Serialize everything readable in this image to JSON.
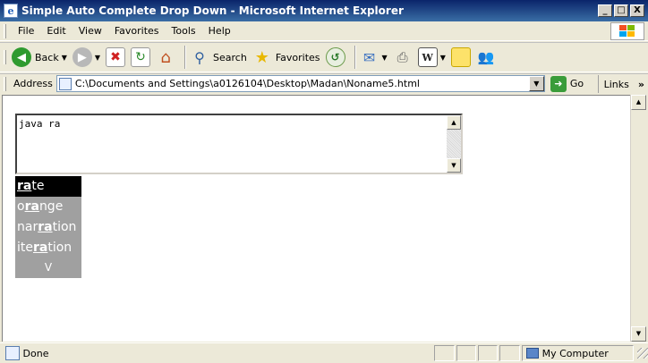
{
  "window": {
    "title": "Simple Auto Complete Drop Down - Microsoft Internet Explorer",
    "minimize": "_",
    "maximize": "□",
    "close": "X"
  },
  "menu": [
    "File",
    "Edit",
    "View",
    "Favorites",
    "Tools",
    "Help"
  ],
  "toolbar": {
    "back_label": "Back",
    "search_label": "Search",
    "favorites_label": "Favorites"
  },
  "address": {
    "label": "Address",
    "url": "C:\\Documents and Settings\\a0126104\\Desktop\\Madan\\Noname5.html",
    "go_label": "Go",
    "links_label": "Links"
  },
  "textarea": {
    "value": "java ra"
  },
  "suggestions": {
    "items": [
      {
        "pre": "",
        "match": "ra",
        "post": "te",
        "selected": true
      },
      {
        "pre": "o",
        "match": "ra",
        "post": "nge",
        "selected": false
      },
      {
        "pre": "nar",
        "match": "ra",
        "post": "tion",
        "selected": false
      },
      {
        "pre": "ite",
        "match": "ra",
        "post": "tion",
        "selected": false
      }
    ],
    "more_glyph": "V"
  },
  "status": {
    "text": "Done",
    "zone": "My Computer"
  },
  "colors": {
    "titlebar": "#0a246a",
    "suggest_bg": "#a0a0a0",
    "suggest_selected": "#000000"
  }
}
